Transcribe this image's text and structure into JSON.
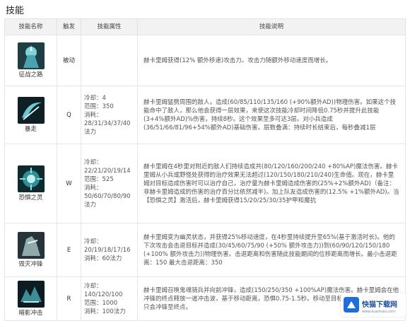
{
  "section_title": "技能",
  "headers": [
    "技能名称",
    "触发",
    "技能属性",
    "技能说明"
  ],
  "colors": {
    "header_bg": "#f2f2f2",
    "border": "#e6e6e6",
    "text": "#555555"
  },
  "skills": [
    {
      "name": "征战之路",
      "key": "被动",
      "attrs": [],
      "desc": "赫卡里姆获得(12% 额外移速)攻击力。攻击力随额外移动速度而增长。",
      "icon": "passive-rider-icon"
    },
    {
      "name": "暴走",
      "key": "Q",
      "attrs": [
        "冷却：4",
        "范围：350",
        "消耗：28/31/34/37/40法力"
      ],
      "desc": "赫卡里姆猛劈周围的敌人，造成(60/85/110/135/160 (+90%额外AD))物理伤害。如果这个技能命中了敌人，那么他会获得一层效果，来使这次技能冷却时间降低0.75秒并提升此技能 (3+4%额外AD)%伤害，持续8秒。这个效果至多可达3层。对小兵造成(36/51/66/81/96+54%额外AD)基础伤害。层数叠满：持续时长结束后，每秒叠减1层",
      "icon": "scythe-icon"
    },
    {
      "name": "恐惧之灵",
      "key": "W",
      "attrs": [
        "冷却：22/21/20/19/14",
        "范围：525",
        "消耗：50/60/70/80/90法力"
      ],
      "desc": "赫卡里姆在4秒里对附近的敌人们持续造成共(80/120/160/200/240 +80%AP)魔法伤害。赫卡里姆从小兵或野怪处获得的治疗效果无法超过(120/150/180/210/240)生命值。现在，赫卡里姆对目标造成伤害时可以治疗自己，治疗量为赫卡里姆造成伤害的(25%+2%额外AD)（备注：非赫卡里姆造成的伤害的治疗百分比依然减半)。加上队友造成伤害的(12.5% +1%额外AD)。当【恐惧之灵】激活后，赫卡里姆获得15/20/25/30/35护甲和魔抗",
      "icon": "spirit-orb-icon"
    },
    {
      "name": "毁灭冲锋",
      "key": "E",
      "attrs": [
        "冷却：20/19/18/17/16",
        "消耗：60法力"
      ],
      "desc": "赫卡里姆变为幽灵状态，并获得25%移动速度，在4秒里持续提升至65%(基于激活时长)。他的下次攻击会击退目标并造成(30/45/60/75/90 (+50% 额外攻击力))到(60/90/120/150/180 (+100% 额外攻击力))物理伤害。击退距离和伤害随此技能期间的位移距离而增长。最小击退距离：150 最大击退距离：350",
      "icon": "charge-rider-icon"
    },
    {
      "name": "暗影冲击",
      "key": "R",
      "attrs": [
        "冷却：140/120/100",
        "范围：1000",
        "消耗：100法力"
      ],
      "desc": "赫卡里姆召唤鬼魂骑兵并向前冲锋，造成(150/250/350 +100%AP)魔法伤害。赫卡里姆会在他冲锋的终点释放一道冲击波，基于移动距离，恐惧0.75-1.5秒。移动至目标位置，但幽魂骑兵们只会冲锋至终点。",
      "icon": "shadow-cavalry-icon"
    }
  ],
  "watermark": {
    "text": "快猫下载网",
    "url": "www.kuaimao.com"
  }
}
